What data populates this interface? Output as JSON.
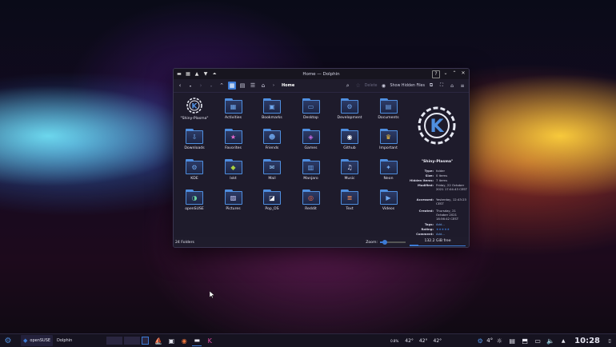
{
  "window": {
    "title": "Home — Dolphin",
    "controls": {
      "help": "?",
      "min": "⌄",
      "max": "⌃",
      "close": "✕"
    }
  },
  "toolbar": {
    "breadcrumb": "Home",
    "delete_label": "Delete",
    "show_hidden_label": "Show Hidden Files"
  },
  "items": [
    {
      "label": "\"Shiny-Plasma\"",
      "icon": "kde-logo-icon"
    },
    {
      "label": "Activities",
      "icon": "activities-icon"
    },
    {
      "label": "Bookmarks",
      "icon": "bookmarks-icon"
    },
    {
      "label": "Desktop",
      "icon": "desktop-icon"
    },
    {
      "label": "Development",
      "icon": "development-icon"
    },
    {
      "label": "Documents",
      "icon": "documents-icon"
    },
    {
      "label": "Downloads",
      "icon": "downloads-icon"
    },
    {
      "label": "Favorites",
      "icon": "favorites-icon"
    },
    {
      "label": "Friends",
      "icon": "friends-icon"
    },
    {
      "label": "Games",
      "icon": "games-icon"
    },
    {
      "label": "Github",
      "icon": "github-icon"
    },
    {
      "label": "Important",
      "icon": "important-icon"
    },
    {
      "label": "KDE",
      "icon": "kde-icon"
    },
    {
      "label": "lxkt",
      "icon": "lxkt-icon"
    },
    {
      "label": "Mail",
      "icon": "mail-icon"
    },
    {
      "label": "Manjaro",
      "icon": "manjaro-icon"
    },
    {
      "label": "Music",
      "icon": "music-icon"
    },
    {
      "label": "Neon",
      "icon": "neon-icon"
    },
    {
      "label": "openSUSE",
      "icon": "opensuse-icon"
    },
    {
      "label": "Pictures",
      "icon": "pictures-icon"
    },
    {
      "label": "Pop_OS",
      "icon": "popos-icon"
    },
    {
      "label": "Reddit",
      "icon": "reddit-icon"
    },
    {
      "label": "Text",
      "icon": "text-icon"
    },
    {
      "label": "Videos",
      "icon": "videos-icon"
    }
  ],
  "info_panel": {
    "title": "\"Shiny-Plasma\"",
    "rows": [
      {
        "key": "Type:",
        "value": "folder"
      },
      {
        "key": "Size:",
        "value": "0 items"
      },
      {
        "key": "Hidden items:",
        "value": "7 items"
      },
      {
        "key": "Modified:",
        "value": "Friday, 22 October 2021 17:04:43 CEST"
      },
      {
        "key": "Accessed:",
        "value": "Yesterday, 12:43:23 CEST"
      },
      {
        "key": "Created:",
        "value": "Thursday, 21 October 2021 18:56:42 CEST"
      },
      {
        "key": "Tags:",
        "value": "Add..."
      },
      {
        "key": "Rating:",
        "value": "★★★★★"
      },
      {
        "key": "Comment:",
        "value": "Add..."
      }
    ]
  },
  "statusbar": {
    "count": "24 Folders",
    "zoom_label": "Zoom:",
    "free_space": "132.2 GiB free",
    "zoom_level": 0.2,
    "free_fraction": 0.15
  },
  "panel": {
    "task_opensuse": "openSUSE",
    "task_dolphin": "Dolphin",
    "disk": "0.8%",
    "temp1": "42°",
    "temp2": "42°",
    "temp3": "42°",
    "weather": "4°",
    "clock": "10:28"
  },
  "colors": {
    "accent": "#3d7bd6",
    "folder_border": "#4f8fe0",
    "window_bg": "#1e1b2b"
  }
}
